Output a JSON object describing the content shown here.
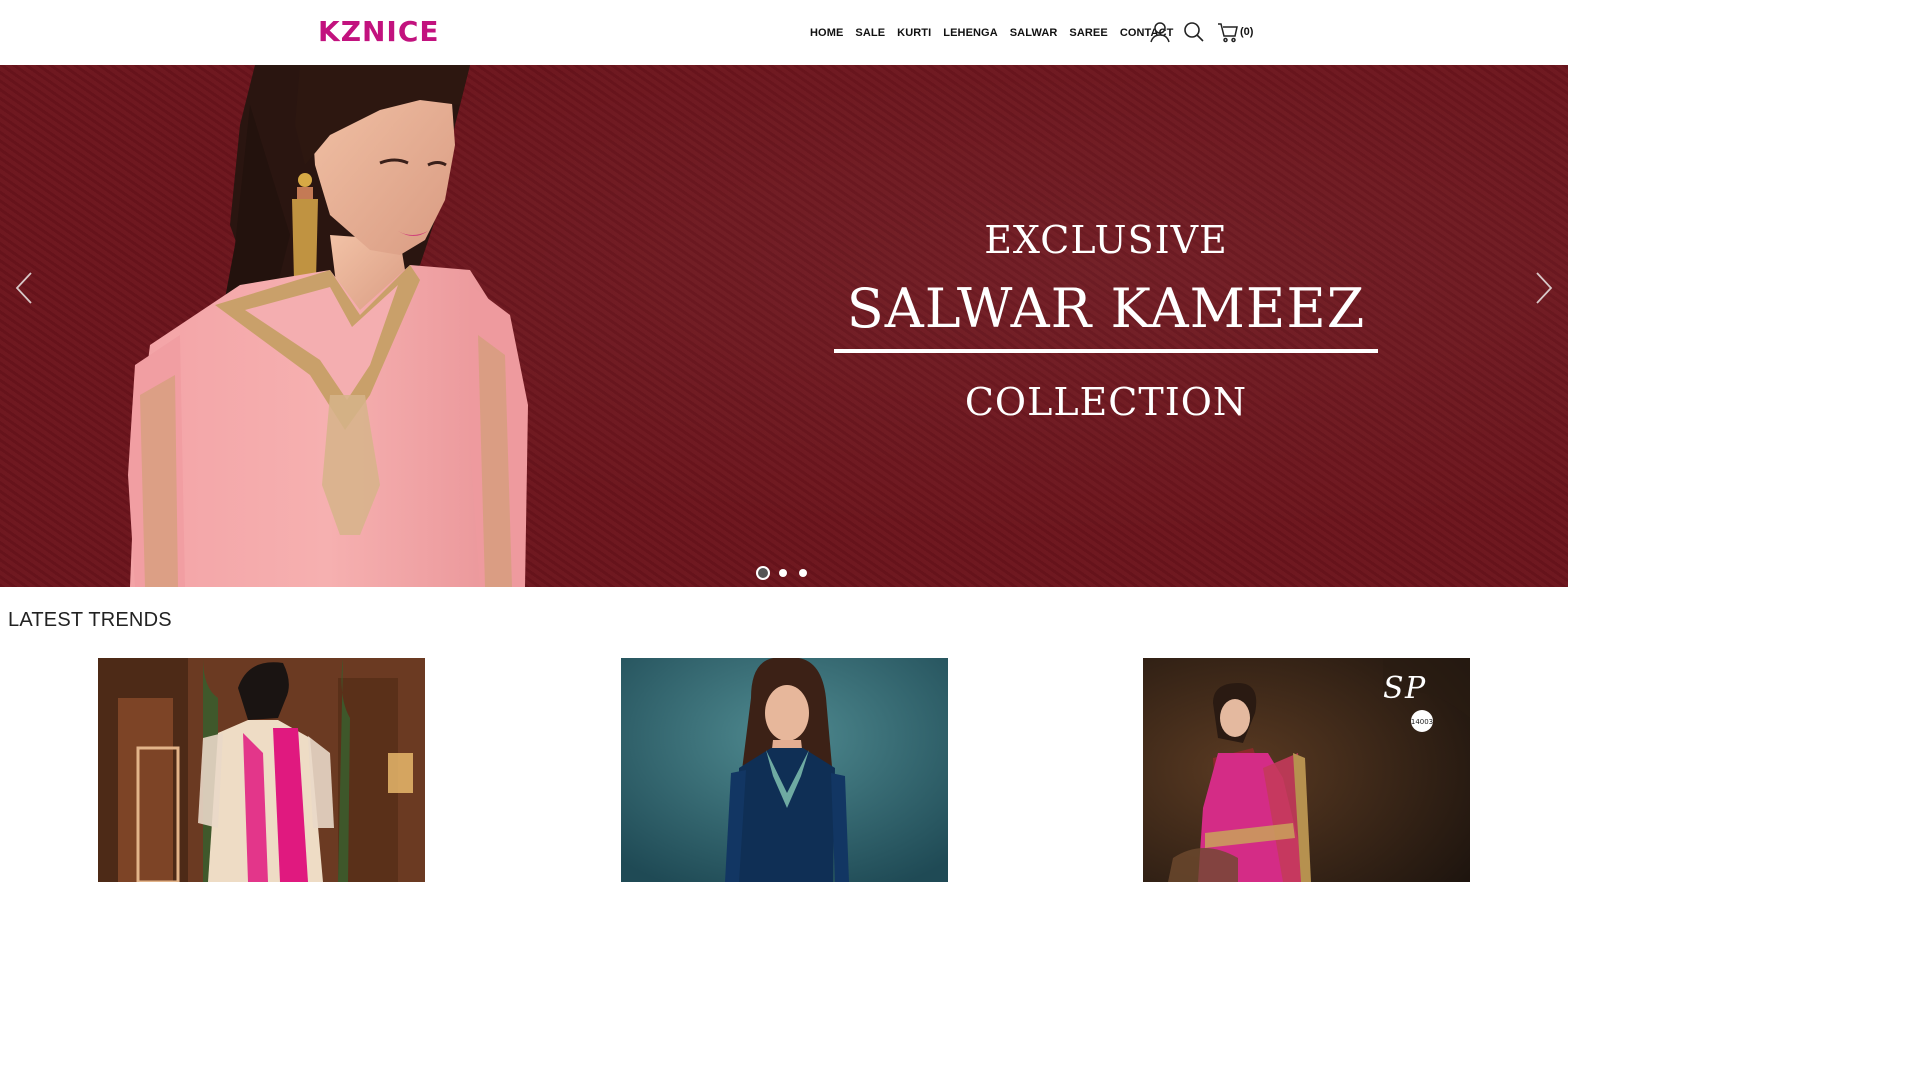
{
  "brand": {
    "logo_text": "KZNICE",
    "color": "#c2127e"
  },
  "nav": {
    "items": [
      {
        "label": "HOME"
      },
      {
        "label": "SALE"
      },
      {
        "label": "KURTI"
      },
      {
        "label": "LEHENGA"
      },
      {
        "label": "SALWAR"
      },
      {
        "label": "SAREE"
      },
      {
        "label": "CONTACT"
      }
    ],
    "icons": [
      "user-icon",
      "search-icon",
      "cart-icon"
    ],
    "cart_count": "(0)"
  },
  "hero": {
    "line1": "EXCLUSIVE",
    "line2": "SALWAR KAMEEZ",
    "line3": "COLLECTION",
    "background_color": "#6c141c",
    "active_slide": 1,
    "slide_count": 3
  },
  "trends": {
    "title": "LATEST TRENDS",
    "products": [
      {
        "image": "model in cream and pink anarkali suit"
      },
      {
        "image": "model in navy blue kurta"
      },
      {
        "image": "model in pink saree"
      }
    ],
    "badge_text": "14003"
  }
}
